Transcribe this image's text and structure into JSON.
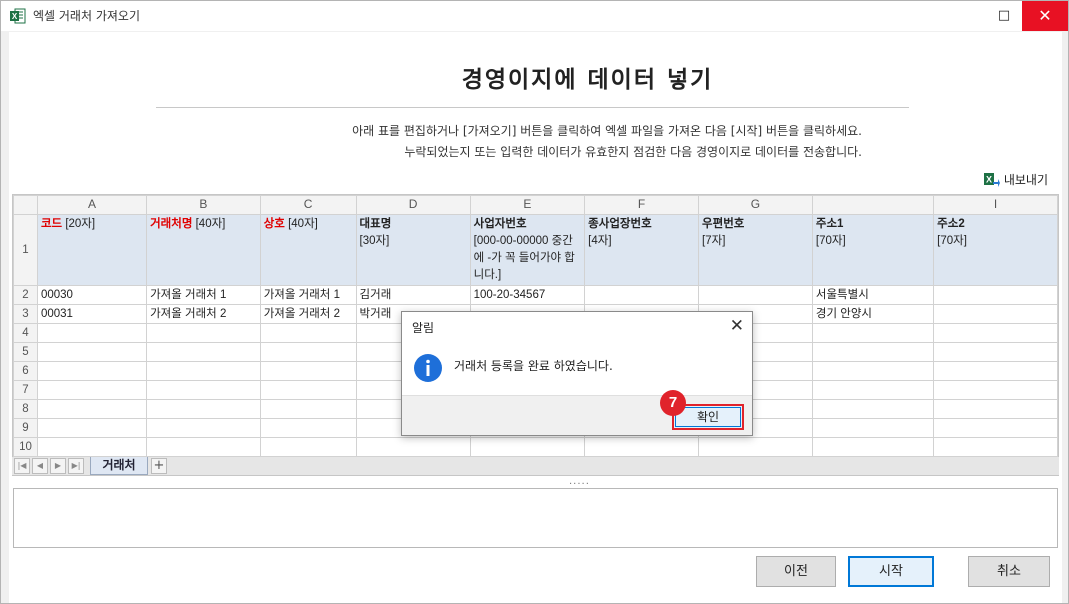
{
  "window": {
    "title": "엑셀 거래처 가져오기",
    "maximize_glyph": "□",
    "close_glyph": "✕"
  },
  "heading": "경영이지에 데이터 넣기",
  "description": [
    "아래 표를 편집하거나 [가져오기] 버튼을 클릭하여 엑셀 파일을 가져온 다음 [시작] 버튼을 클릭하세요.",
    "누락되었는지 또는 입력한 데이터가 유효한지 점검한 다음 경영이지로 데이터를 전송합니다."
  ],
  "export_label": "내보내기",
  "sheet": {
    "columns": [
      "A",
      "B",
      "C",
      "D",
      "E",
      "F",
      "G",
      "",
      "I"
    ],
    "header_row_number": "1",
    "headers": [
      {
        "name": "코드",
        "spec": "[20자]",
        "required": true
      },
      {
        "name": "거래처명",
        "spec": "[40자]",
        "required": true
      },
      {
        "name": "상호",
        "spec": "[40자]",
        "required": true
      },
      {
        "name": "대표명",
        "spec": "[30자]",
        "required": false
      },
      {
        "name": "사업자번호",
        "spec": "[000-00-00000 중간에 -가 꼭 들어가야 합니다.]",
        "required": false
      },
      {
        "name": "종사업장번호",
        "spec": "[4자]",
        "required": false
      },
      {
        "name": "우편번호",
        "spec": "[7자]",
        "required": false
      },
      {
        "name": "주소1",
        "spec": "[70자]",
        "required": false
      },
      {
        "name": "주소2",
        "spec": "[70자]",
        "required": false
      }
    ],
    "rows": [
      {
        "num": "2",
        "cells": [
          "00030",
          "가져올 거래처 1",
          "가져올 거래처 1",
          "김거래",
          "100-20-34567",
          "",
          "",
          "서울특별시",
          ""
        ]
      },
      {
        "num": "3",
        "cells": [
          "00031",
          "가져올 거래처 2",
          "가져올 거래처 2",
          "박거래",
          "",
          "",
          "",
          "경기 안양시",
          ""
        ]
      },
      {
        "num": "4",
        "cells": [
          "",
          "",
          "",
          "",
          "",
          "",
          "",
          "",
          ""
        ]
      },
      {
        "num": "5",
        "cells": [
          "",
          "",
          "",
          "",
          "",
          "",
          "",
          "",
          ""
        ]
      },
      {
        "num": "6",
        "cells": [
          "",
          "",
          "",
          "",
          "",
          "",
          "",
          "",
          ""
        ]
      },
      {
        "num": "7",
        "cells": [
          "",
          "",
          "",
          "",
          "",
          "",
          "",
          "",
          ""
        ]
      },
      {
        "num": "8",
        "cells": [
          "",
          "",
          "",
          "",
          "",
          "",
          "",
          "",
          ""
        ]
      },
      {
        "num": "9",
        "cells": [
          "",
          "",
          "",
          "",
          "",
          "",
          "",
          "",
          ""
        ]
      },
      {
        "num": "10",
        "cells": [
          "",
          "",
          "",
          "",
          "",
          "",
          "",
          "",
          ""
        ]
      }
    ],
    "tab_name": "거래처",
    "add_tab_glyph": "+"
  },
  "splitter_glyph": ".....",
  "buttons": {
    "prev": "이전",
    "start": "시작",
    "cancel": "취소"
  },
  "dialog": {
    "title": "알림",
    "close_glyph": "✕",
    "message": "거래처 등록을 완료 하였습니다.",
    "ok": "확인"
  },
  "step_badge": "7",
  "colors": {
    "required_red": "#e00000",
    "header_fill": "#dde6f1",
    "highlight_red": "#e0232b",
    "focus_blue": "#0078d7"
  }
}
